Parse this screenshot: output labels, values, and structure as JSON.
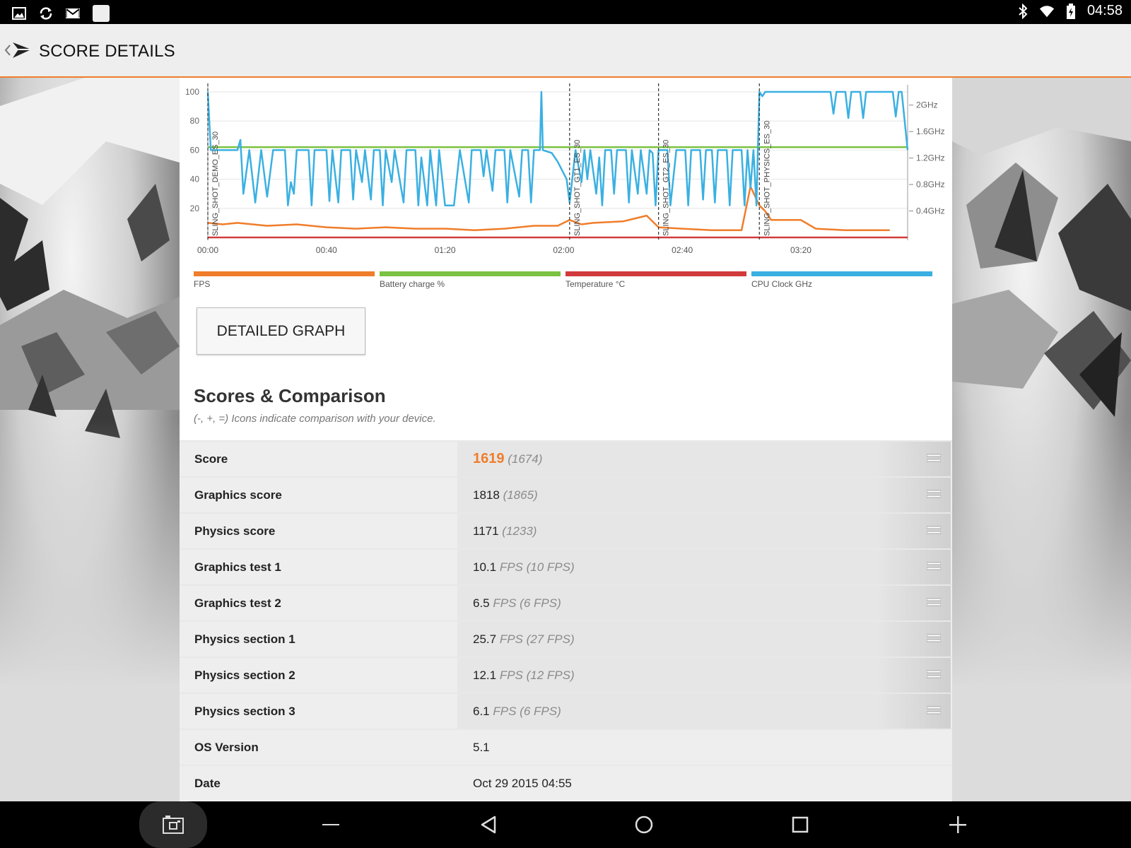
{
  "status_bar": {
    "time": "04:58",
    "left_icons": [
      "image-icon",
      "sync-icon",
      "gmail-icon",
      "app-square-icon"
    ],
    "right_icons": [
      "bluetooth-icon",
      "wifi-icon",
      "battery-charging-icon"
    ]
  },
  "app_bar": {
    "title": "SCORE DETAILS"
  },
  "chart_data": {
    "type": "line",
    "x_tick_labels": [
      "00:00",
      "00:40",
      "01:20",
      "02:00",
      "02:40",
      "03:20"
    ],
    "x_seconds_range": [
      0,
      236
    ],
    "y_left_ticks": [
      "20",
      "40",
      "60",
      "80",
      "100"
    ],
    "y_left_range": [
      0,
      100
    ],
    "y_right_ticks": [
      "0.4GHz",
      "0.8GHz",
      "1.2GHz",
      "1.6GHz",
      "2GHz"
    ],
    "y_right_range_ghz": [
      0,
      2.2
    ],
    "markers": [
      {
        "t": 0,
        "label": "SLING_SHOT_DEMO_ES_30"
      },
      {
        "t": 122,
        "label": "SLING_SHOT_GT1_ES_30"
      },
      {
        "t": 152,
        "label": "SLING_SHOT_GT2_ES_30"
      },
      {
        "t": 186,
        "label": "SLING_SHOT_PHYSICS_ES_30"
      }
    ],
    "series": [
      {
        "name": "FPS",
        "color": "#f07d2a",
        "axis": "left",
        "points": [
          [
            0,
            10
          ],
          [
            5,
            9
          ],
          [
            10,
            10
          ],
          [
            20,
            8
          ],
          [
            30,
            9
          ],
          [
            40,
            7
          ],
          [
            50,
            6
          ],
          [
            60,
            7
          ],
          [
            70,
            6
          ],
          [
            80,
            6
          ],
          [
            90,
            5
          ],
          [
            100,
            6
          ],
          [
            110,
            8
          ],
          [
            118,
            8
          ],
          [
            122,
            12
          ],
          [
            126,
            9
          ],
          [
            130,
            10
          ],
          [
            140,
            11
          ],
          [
            148,
            15
          ],
          [
            152,
            7
          ],
          [
            160,
            6
          ],
          [
            170,
            5
          ],
          [
            180,
            5
          ],
          [
            183,
            35
          ],
          [
            186,
            22
          ],
          [
            188,
            18
          ],
          [
            190,
            12
          ],
          [
            200,
            12
          ],
          [
            205,
            6
          ],
          [
            215,
            5
          ],
          [
            225,
            5
          ],
          [
            230,
            5
          ]
        ]
      },
      {
        "name": "Battery charge %",
        "color": "#7cc243",
        "axis": "left",
        "points": [
          [
            0,
            62
          ],
          [
            236,
            62
          ]
        ]
      },
      {
        "name": "Temperature °C",
        "color": "#d23b3b",
        "axis": "left",
        "points": [
          [
            0,
            0
          ],
          [
            236,
            0
          ]
        ]
      },
      {
        "name": "CPU Clock GHz",
        "color": "#3ab0e2",
        "axis": "left",
        "points": [
          [
            0,
            100
          ],
          [
            1,
            60
          ],
          [
            10,
            60
          ],
          [
            11,
            67
          ],
          [
            12,
            30
          ],
          [
            14,
            60
          ],
          [
            16,
            24
          ],
          [
            18,
            60
          ],
          [
            20,
            28
          ],
          [
            22,
            60
          ],
          [
            26,
            60
          ],
          [
            27,
            22
          ],
          [
            28,
            38
          ],
          [
            29,
            30
          ],
          [
            30,
            60
          ],
          [
            34,
            60
          ],
          [
            35,
            22
          ],
          [
            36,
            60
          ],
          [
            40,
            60
          ],
          [
            41,
            25
          ],
          [
            42,
            60
          ],
          [
            44,
            24
          ],
          [
            45,
            60
          ],
          [
            48,
            60
          ],
          [
            49,
            26
          ],
          [
            50,
            60
          ],
          [
            52,
            38
          ],
          [
            53,
            60
          ],
          [
            55,
            26
          ],
          [
            56,
            60
          ],
          [
            58,
            60
          ],
          [
            59,
            22
          ],
          [
            60,
            60
          ],
          [
            62,
            38
          ],
          [
            63,
            60
          ],
          [
            66,
            24
          ],
          [
            67,
            60
          ],
          [
            70,
            60
          ],
          [
            71,
            22
          ],
          [
            72,
            55
          ],
          [
            74,
            22
          ],
          [
            75,
            60
          ],
          [
            77,
            22
          ],
          [
            78,
            60
          ],
          [
            80,
            22
          ],
          [
            83,
            22
          ],
          [
            85,
            60
          ],
          [
            88,
            24
          ],
          [
            89,
            60
          ],
          [
            92,
            60
          ],
          [
            93,
            42
          ],
          [
            94,
            60
          ],
          [
            96,
            32
          ],
          [
            97,
            60
          ],
          [
            100,
            60
          ],
          [
            101,
            24
          ],
          [
            102,
            60
          ],
          [
            105,
            28
          ],
          [
            106,
            60
          ],
          [
            108,
            60
          ],
          [
            109,
            24
          ],
          [
            110,
            60
          ],
          [
            112,
            60
          ],
          [
            112.5,
            100
          ],
          [
            113,
            60
          ],
          [
            116,
            58
          ],
          [
            118,
            52
          ],
          [
            121,
            40
          ],
          [
            122,
            24
          ],
          [
            124,
            60
          ],
          [
            126,
            38
          ],
          [
            127,
            60
          ],
          [
            128,
            40
          ],
          [
            129,
            60
          ],
          [
            131,
            30
          ],
          [
            132,
            55
          ],
          [
            133,
            22
          ],
          [
            134,
            60
          ],
          [
            136,
            60
          ],
          [
            137,
            30
          ],
          [
            138,
            60
          ],
          [
            141,
            60
          ],
          [
            142,
            24
          ],
          [
            143,
            60
          ],
          [
            145,
            30
          ],
          [
            146,
            60
          ],
          [
            148,
            30
          ],
          [
            149,
            60
          ],
          [
            150,
            58
          ],
          [
            151,
            22
          ],
          [
            152,
            60
          ],
          [
            155,
            60
          ],
          [
            156,
            22
          ],
          [
            158,
            60
          ],
          [
            161,
            60
          ],
          [
            162,
            22
          ],
          [
            163,
            60
          ],
          [
            166,
            60
          ],
          [
            167,
            26
          ],
          [
            168,
            60
          ],
          [
            170,
            60
          ],
          [
            171,
            24
          ],
          [
            172,
            60
          ],
          [
            175,
            60
          ],
          [
            176,
            22
          ],
          [
            177,
            60
          ],
          [
            180,
            60
          ],
          [
            181,
            22
          ],
          [
            182,
            60
          ],
          [
            183,
            34
          ],
          [
            184,
            60
          ],
          [
            185,
            22
          ],
          [
            186,
            100
          ],
          [
            187,
            97
          ],
          [
            188,
            100
          ],
          [
            210,
            100
          ],
          [
            211,
            85
          ],
          [
            212,
            100
          ],
          [
            215,
            100
          ],
          [
            216,
            82
          ],
          [
            217,
            100
          ],
          [
            220,
            100
          ],
          [
            221,
            82
          ],
          [
            222,
            100
          ],
          [
            231,
            100
          ],
          [
            232,
            83
          ],
          [
            233,
            100
          ],
          [
            234,
            100
          ],
          [
            236,
            60
          ]
        ]
      }
    ]
  },
  "legend": [
    {
      "label": "FPS",
      "color": "#f07d2a"
    },
    {
      "label": "Battery charge %",
      "color": "#7cc243"
    },
    {
      "label": "Temperature °C",
      "color": "#d23b3b"
    },
    {
      "label": "CPU Clock GHz",
      "color": "#3ab0e2"
    }
  ],
  "detailed_graph_button": "DETAILED GRAPH",
  "scores_section": {
    "title": "Scores & Comparison",
    "subtitle": "(-, +, =) Icons indicate comparison with your device."
  },
  "scores": {
    "score": {
      "label": "Score",
      "value": "1619",
      "compare": "(1674)"
    },
    "graphics_score": {
      "label": "Graphics score",
      "value": "1818",
      "compare": "(1865)"
    },
    "physics_score": {
      "label": "Physics score",
      "value": "1171",
      "compare": "(1233)"
    },
    "graphics_test_1": {
      "label": "Graphics test 1",
      "value": "10.1",
      "unit": "FPS",
      "compare": "(10 FPS)"
    },
    "graphics_test_2": {
      "label": "Graphics test 2",
      "value": "6.5",
      "unit": "FPS",
      "compare": "(6 FPS)"
    },
    "physics_section_1": {
      "label": "Physics section 1",
      "value": "25.7",
      "unit": "FPS",
      "compare": "(27 FPS)"
    },
    "physics_section_2": {
      "label": "Physics section 2",
      "value": "12.1",
      "unit": "FPS",
      "compare": "(12 FPS)"
    },
    "physics_section_3": {
      "label": "Physics section 3",
      "value": "6.1",
      "unit": "FPS",
      "compare": "(6 FPS)"
    },
    "os_version": {
      "label": "OS Version",
      "value": "5.1"
    },
    "date": {
      "label": "Date",
      "value": "Oct 29 2015 04:55"
    }
  },
  "nav_bar": {
    "icons": [
      "screenshot-icon",
      "volume-down-icon",
      "back-icon",
      "home-icon",
      "recents-icon",
      "volume-up-icon"
    ]
  }
}
